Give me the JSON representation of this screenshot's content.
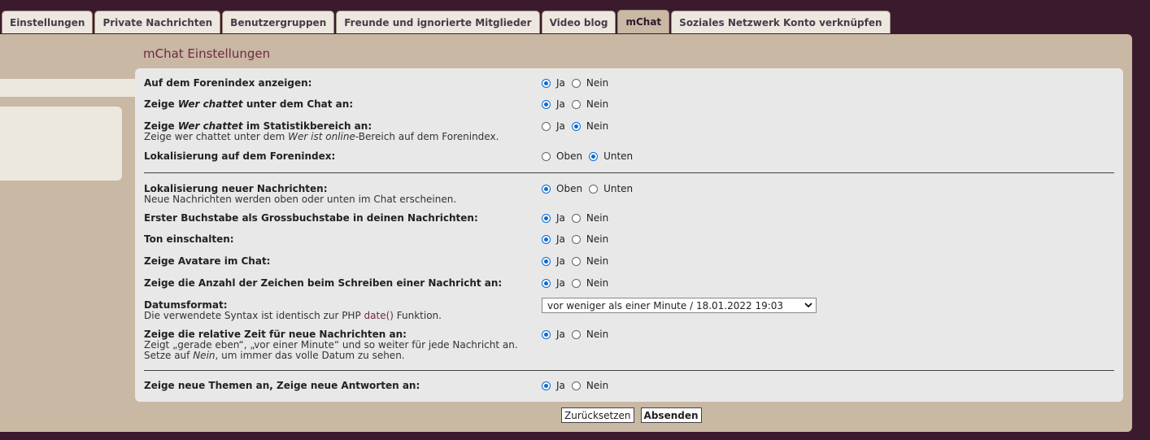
{
  "tabs": [
    {
      "label": "Einstellungen",
      "active": false
    },
    {
      "label": "Private Nachrichten",
      "active": false
    },
    {
      "label": "Benutzergruppen",
      "active": false
    },
    {
      "label": "Freunde und ignorierte Mitglieder",
      "active": false
    },
    {
      "label": "Video blog",
      "active": false
    },
    {
      "label": "mChat",
      "active": true
    },
    {
      "label": "Soziales Netzwerk Konto verknüpfen",
      "active": false
    }
  ],
  "section_title": "mChat Einstellungen",
  "options": {
    "ja": "Ja",
    "nein": "Nein",
    "oben": "Oben",
    "unten": "Unten"
  },
  "settings": [
    {
      "pre": "Auf dem Forenindex anzeigen:",
      "value": "Ja"
    },
    {
      "pre": "Zeige ",
      "em": "Wer chattet",
      "post": " unter dem Chat an:",
      "value": "Ja"
    },
    {
      "pre": "Zeige ",
      "em": "Wer chattet",
      "post": " im Statistikbereich an:",
      "desc_pre": "Zeige wer chattet unter dem ",
      "desc_em": "Wer ist online",
      "desc_post": "-Bereich auf dem Forenindex.",
      "value": "Nein"
    },
    {
      "pre": "Lokalisierung auf dem Forenindex:",
      "value": "Unten"
    },
    {
      "pre": "Lokalisierung neuer Nachrichten:",
      "desc": "Neue Nachrichten werden oben oder unten im Chat erscheinen.",
      "value": "Oben"
    },
    {
      "pre": "Erster Buchstabe als Grossbuchstabe in deinen Nachrichten:",
      "value": "Ja"
    },
    {
      "pre": "Ton einschalten:",
      "value": "Ja"
    },
    {
      "pre": "Zeige Avatare im Chat:",
      "value": "Ja"
    },
    {
      "pre": "Zeige die Anzahl der Zeichen beim Schreiben einer Nachricht an:",
      "value": "Ja"
    },
    {
      "pre": "Datumsformat:",
      "desc_pre": "Die verwendete Syntax ist identisch zur PHP ",
      "desc_link": "date()",
      "desc_post": " Funktion.",
      "select_value": "vor weniger als einer Minute / 18.01.2022 19:03"
    },
    {
      "pre": "Zeige die relative Zeit für neue Nachrichten an:",
      "desc": "Zeigt „gerade eben“, „vor einer Minute“ und so weiter für jede Nachricht an.",
      "desc2_pre": "Setze auf ",
      "desc2_em": "Nein",
      "desc2_post": ", um immer das volle Datum zu sehen.",
      "value": "Ja"
    },
    {
      "pre": "Zeige neue Themen an, Zeige neue Antworten an:",
      "value": "Ja"
    }
  ],
  "buttons": {
    "reset": "Zurücksetzen",
    "submit": "Absenden"
  }
}
